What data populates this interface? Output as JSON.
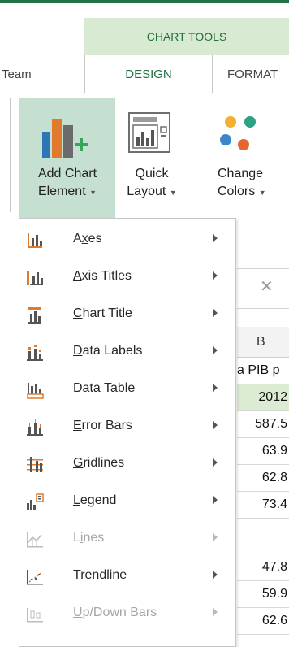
{
  "context_header": "CHART TOOLS",
  "tabs": {
    "team": "Team",
    "design": "DESIGN",
    "format": "FORMAT"
  },
  "ribbon": {
    "add_chart_element": {
      "line1": "Add Chart",
      "line2": "Element"
    },
    "quick_layout": {
      "line1": "Quick",
      "line2": "Layout"
    },
    "change_colors": {
      "line1": "Change",
      "line2": "Colors"
    }
  },
  "menu": {
    "items": [
      {
        "label": "Axes",
        "accel": "x",
        "icon": "axes-icon",
        "enabled": true
      },
      {
        "label": "Axis Titles",
        "accel": "A",
        "icon": "axis-titles-icon",
        "enabled": true
      },
      {
        "label": "Chart Title",
        "accel": "C",
        "icon": "chart-title-icon",
        "enabled": true
      },
      {
        "label": "Data Labels",
        "accel": "D",
        "icon": "data-labels-icon",
        "enabled": true
      },
      {
        "label": "Data Table",
        "accel": "b",
        "icon": "data-table-icon",
        "enabled": true
      },
      {
        "label": "Error Bars",
        "accel": "E",
        "icon": "error-bars-icon",
        "enabled": true
      },
      {
        "label": "Gridlines",
        "accel": "G",
        "icon": "gridlines-icon",
        "enabled": true
      },
      {
        "label": "Legend",
        "accel": "L",
        "icon": "legend-icon",
        "enabled": true
      },
      {
        "label": "Lines",
        "accel": "i",
        "icon": "lines-icon",
        "enabled": false
      },
      {
        "label": "Trendline",
        "accel": "T",
        "icon": "trendline-icon",
        "enabled": true
      },
      {
        "label": "Up/Down Bars",
        "accel": "U",
        "icon": "up-down-bars-icon",
        "enabled": false
      }
    ]
  },
  "sheet": {
    "column_header": "B",
    "header_cell": "a PIB p",
    "year": "2012",
    "values": [
      "587.5",
      "63.9",
      "62.8",
      "73.4",
      "47.8",
      "59.9",
      "62.6"
    ]
  },
  "colors": {
    "accent": "#217346",
    "context_bg": "#d9ead3",
    "selected_button_bg": "#c5dfd0"
  }
}
